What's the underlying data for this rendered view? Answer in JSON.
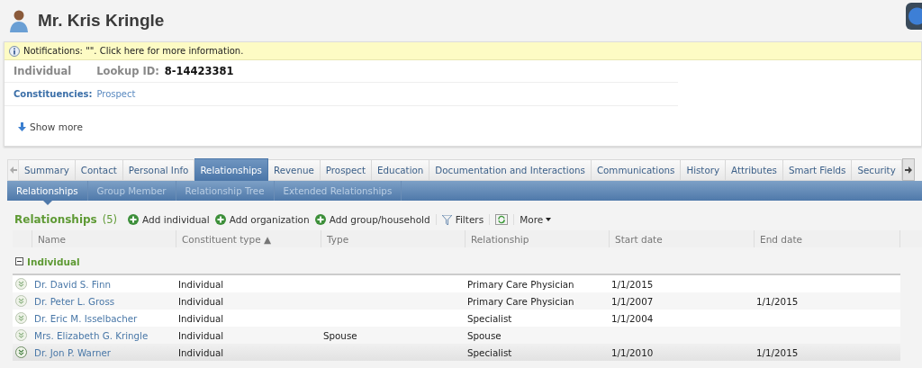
{
  "header": {
    "title": "Mr. Kris Kringle"
  },
  "notification": {
    "text": "Notifications: \"\". Click here for more information."
  },
  "summary": {
    "type": "Individual",
    "lookup_label": "Lookup ID:",
    "lookup_id": "8-14423381",
    "constituencies_label": "Constituencies:",
    "constituencies_value": "Prospect",
    "show_more": "Show more"
  },
  "tabs": [
    {
      "label": "Summary",
      "selected": false
    },
    {
      "label": "Contact",
      "selected": false
    },
    {
      "label": "Personal Info",
      "selected": false
    },
    {
      "label": "Relationships",
      "selected": true
    },
    {
      "label": "Revenue",
      "selected": false
    },
    {
      "label": "Prospect",
      "selected": false
    },
    {
      "label": "Education",
      "selected": false
    },
    {
      "label": "Documentation and Interactions",
      "selected": false
    },
    {
      "label": "Communications",
      "selected": false
    },
    {
      "label": "History",
      "selected": false
    },
    {
      "label": "Attributes",
      "selected": false
    },
    {
      "label": "Smart Fields",
      "selected": false
    },
    {
      "label": "Security",
      "selected": false
    }
  ],
  "subtabs": [
    {
      "label": "Relationships",
      "selected": true
    },
    {
      "label": "Group Member",
      "selected": false
    },
    {
      "label": "Relationship Tree",
      "selected": false
    },
    {
      "label": "Extended Relationships",
      "selected": false
    }
  ],
  "toolbar": {
    "title": "Relationships",
    "count": "(5)",
    "actions": [
      "Add individual",
      "Add organization",
      "Add group/household"
    ],
    "filters": "Filters",
    "more": "More"
  },
  "table": {
    "columns": [
      "Name",
      "Constituent type ▲",
      "Type",
      "Relationship",
      "Start date",
      "End date"
    ],
    "group": {
      "label": "Individual",
      "expanded": true
    },
    "rows": [
      {
        "cells": [
          "Dr. David S. Finn",
          "Individual",
          "",
          "Primary Care Physician",
          "1/1/2015",
          ""
        ],
        "selected": false
      },
      {
        "cells": [
          "Dr. Peter L. Gross",
          "Individual",
          "",
          "Primary Care Physician",
          "1/1/2007",
          "1/1/2015"
        ],
        "selected": false
      },
      {
        "cells": [
          "Dr. Eric M. Isselbacher",
          "Individual",
          "",
          "Specialist",
          "1/1/2004",
          ""
        ],
        "selected": false
      },
      {
        "cells": [
          "Mrs. Elizabeth G. Kringle",
          "Individual",
          "Spouse",
          "Spouse",
          "",
          ""
        ],
        "selected": false
      },
      {
        "cells": [
          "Dr. Jon P. Warner",
          "Individual",
          "",
          "Specialist",
          "1/1/2010",
          "1/1/2015"
        ],
        "selected": true
      }
    ]
  }
}
